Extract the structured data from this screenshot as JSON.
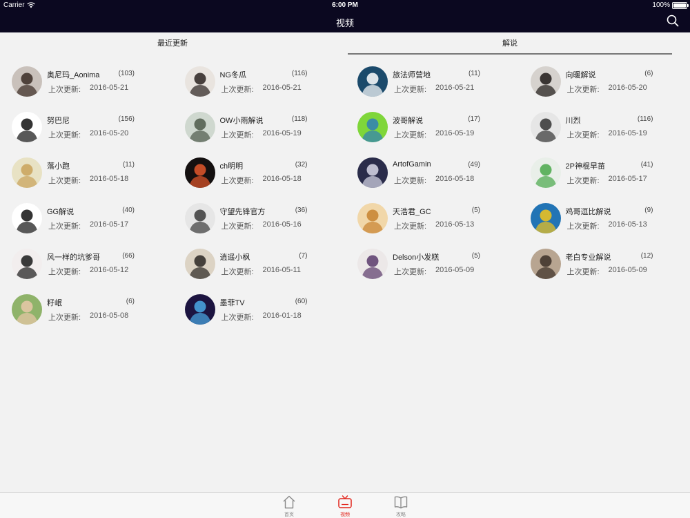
{
  "status_bar": {
    "carrier": "Carrier",
    "time": "6:00 PM",
    "battery": "100%",
    "battery_level": 1.0
  },
  "nav": {
    "title": "视频",
    "search_icon": "search-icon"
  },
  "tabs": [
    {
      "label": "最近更新",
      "selected": false
    },
    {
      "label": "解说",
      "selected": true
    }
  ],
  "update_label": "上次更新:",
  "streamers": [
    {
      "name": "奥尼玛_Aonima",
      "count": "(103)",
      "date": "2016-05-21",
      "avatar": {
        "bg": "#c9c1bb",
        "fg": "#3a2b24"
      }
    },
    {
      "name": "NG冬瓜",
      "count": "(116)",
      "date": "2016-05-21",
      "avatar": {
        "bg": "#e9e4df",
        "fg": "#2a2220"
      }
    },
    {
      "name": "旅法师营地",
      "count": "(11)",
      "date": "2016-05-21",
      "avatar": {
        "bg": "#1b4a6b",
        "fg": "#ffffff"
      }
    },
    {
      "name": "向暖解说",
      "count": "(6)",
      "date": "2016-05-20",
      "avatar": {
        "bg": "#d6d2ce",
        "fg": "#1e1a18"
      }
    },
    {
      "name": "努巴尼",
      "count": "(156)",
      "date": "2016-05-20",
      "avatar": {
        "bg": "#ffffff",
        "fg": "#111111"
      }
    },
    {
      "name": "OW小雨解说",
      "count": "(118)",
      "date": "2016-05-19",
      "avatar": {
        "bg": "#cfd8cf",
        "fg": "#4d5a4a"
      }
    },
    {
      "name": "波哥解说",
      "count": "(17)",
      "date": "2016-05-19",
      "avatar": {
        "bg": "#7fd63a",
        "fg": "#2f7fb8"
      }
    },
    {
      "name": "川烈",
      "count": "(116)",
      "date": "2016-05-19",
      "avatar": {
        "bg": "#e6e6e6",
        "fg": "#333333"
      }
    },
    {
      "name": "落小跑",
      "count": "(11)",
      "date": "2016-05-18",
      "avatar": {
        "bg": "#e8e2c4",
        "fg": "#c9a25b"
      }
    },
    {
      "name": "ch明明",
      "count": "(32)",
      "date": "2016-05-18",
      "avatar": {
        "bg": "#141010",
        "fg": "#e2572b"
      }
    },
    {
      "name": "ArtofGamin",
      "count": "(49)",
      "date": "2016-05-18",
      "avatar": {
        "bg": "#2a2c4a",
        "fg": "#d8d8e8"
      }
    },
    {
      "name": "2P神棍早苗",
      "count": "(41)",
      "date": "2016-05-17",
      "avatar": {
        "bg": "#e9efe9",
        "fg": "#49a84a"
      }
    },
    {
      "name": "GG解说",
      "count": "(40)",
      "date": "2016-05-17",
      "avatar": {
        "bg": "#ffffff",
        "fg": "#111111"
      }
    },
    {
      "name": "守望先锋官方",
      "count": "(36)",
      "date": "2016-05-16",
      "avatar": {
        "bg": "#e6e6e6",
        "fg": "#3a3a3a"
      }
    },
    {
      "name": "天浩君_GC",
      "count": "(5)",
      "date": "2016-05-13",
      "avatar": {
        "bg": "#f1d7a9",
        "fg": "#c7822f"
      }
    },
    {
      "name": "鸡哥逗比解说",
      "count": "(9)",
      "date": "2016-05-13",
      "avatar": {
        "bg": "#2274b5",
        "fg": "#f3c51a"
      }
    },
    {
      "name": "风一样的坑爹哥",
      "count": "(66)",
      "date": "2016-05-12",
      "avatar": {
        "bg": "#f2eeee",
        "fg": "#1a1a1a"
      }
    },
    {
      "name": "逍遥小枫",
      "count": "(7)",
      "date": "2016-05-11",
      "avatar": {
        "bg": "#dcd3c4",
        "fg": "#2a2623"
      }
    },
    {
      "name": "Delson小发糕",
      "count": "(5)",
      "date": "2016-05-09",
      "avatar": {
        "bg": "#ece8e8",
        "fg": "#5b3a6b"
      }
    },
    {
      "name": "老白专业解说",
      "count": "(12)",
      "date": "2016-05-09",
      "avatar": {
        "bg": "#b8a591",
        "fg": "#3b2f27"
      }
    },
    {
      "name": "籽岷",
      "count": "(6)",
      "date": "2016-05-08",
      "avatar": {
        "bg": "#8fb36a",
        "fg": "#e9c8a8"
      }
    },
    {
      "name": "墨菲TV",
      "count": "(60)",
      "date": "2016-01-18",
      "avatar": {
        "bg": "#1c1440",
        "fg": "#4aa9e6"
      }
    }
  ],
  "tabbar": [
    {
      "label": "首页",
      "icon": "home-icon",
      "active": false
    },
    {
      "label": "视频",
      "icon": "tv-icon",
      "active": true
    },
    {
      "label": "攻略",
      "icon": "book-icon",
      "active": false
    }
  ],
  "colors": {
    "header_bg": "#0b0820",
    "active": "#e2231a",
    "inactive": "#888888",
    "page_bg": "#f2f2f2"
  }
}
